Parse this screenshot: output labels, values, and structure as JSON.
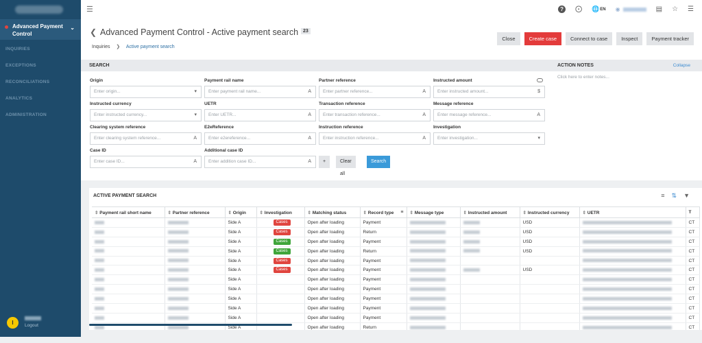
{
  "sidebar": {
    "active_item": "Advanced Payment Control",
    "items": [
      "INQUIRIES",
      "EXCEPTIONS",
      "RECONCILIATIONS",
      "ANALYTICS",
      "ADMINISTRATION"
    ],
    "user_initial": "I",
    "logout": "Logout"
  },
  "topbar": {
    "lang": "EN"
  },
  "header": {
    "title": "Advanced Payment Control - Active payment search",
    "count": "23",
    "breadcrumb_root": "Inquiries",
    "breadcrumb_current": "Active payment search",
    "actions": [
      "Close",
      "Create case",
      "Connect to case",
      "Inspect",
      "Payment tracker"
    ]
  },
  "search": {
    "heading": "SEARCH",
    "fields": [
      {
        "label": "Origin",
        "placeholder": "Enter origin...",
        "icon": "chevron"
      },
      {
        "label": "Payment rail name",
        "placeholder": "Enter payment rail name...",
        "icon": "text"
      },
      {
        "label": "Partner reference",
        "placeholder": "Enter partner reference...",
        "icon": "text"
      },
      {
        "label": "Instructed amount",
        "placeholder": "Enter instructed amount...",
        "icon": "dollar"
      },
      {
        "label": "Instructed currency",
        "placeholder": "Enter instructed currency...",
        "icon": "chevron"
      },
      {
        "label": "UETR",
        "placeholder": "Enter UETR...",
        "icon": "text"
      },
      {
        "label": "Transaction reference",
        "placeholder": "Enter transaction reference...",
        "icon": "text"
      },
      {
        "label": "Message reference",
        "placeholder": "Enter message reference...",
        "icon": "text"
      },
      {
        "label": "Clearing system reference",
        "placeholder": "Enter clearing system reference...",
        "icon": "text"
      },
      {
        "label": "E2eReference",
        "placeholder": "Enter e2ereference...",
        "icon": "text"
      },
      {
        "label": "Instruction reference",
        "placeholder": "Enter instruction reference...",
        "icon": "text"
      },
      {
        "label": "Investigation",
        "placeholder": "Enter investigation...",
        "icon": "chevron"
      },
      {
        "label": "Case ID",
        "placeholder": "Enter case ID...",
        "icon": "text"
      },
      {
        "label": "Additional case ID",
        "placeholder": "Enter addition case ID...",
        "icon": "text"
      }
    ],
    "add_label": "+",
    "clear_label": "Clear all",
    "search_label": "Search"
  },
  "notes": {
    "heading": "ACTION NOTES",
    "collapse": "Collapse",
    "placeholder": "Click here to enter notes..."
  },
  "results": {
    "heading": "ACTIVE PAYMENT SEARCH",
    "columns": [
      "Payment rail short name",
      "Partner reference",
      "Origin",
      "Investigation",
      "Matching status",
      "Record type",
      "Message type",
      "Instructed amount",
      "Instructed currency",
      "UETR",
      "T"
    ],
    "rows": [
      {
        "origin": "Side A",
        "inv": "Cases",
        "inv_color": "red",
        "status": "Open after loading",
        "type": "Payment",
        "amt": true,
        "cur": "USD",
        "last": "CT"
      },
      {
        "origin": "Side A",
        "inv": "Cases",
        "inv_color": "red",
        "status": "Open after loading",
        "type": "Return",
        "amt": true,
        "cur": "USD",
        "last": "CT"
      },
      {
        "origin": "Side A",
        "inv": "Cases",
        "inv_color": "green",
        "status": "Open after loading",
        "type": "Payment",
        "amt": true,
        "cur": "USD",
        "last": "CT"
      },
      {
        "origin": "Side A",
        "inv": "Cases",
        "inv_color": "green",
        "status": "Open after loading",
        "type": "Return",
        "amt": true,
        "cur": "USD",
        "last": "CT"
      },
      {
        "origin": "Side A",
        "inv": "Cases",
        "inv_color": "red",
        "status": "Open after loading",
        "type": "Payment",
        "amt": false,
        "cur": "",
        "last": "CT"
      },
      {
        "origin": "Side A",
        "inv": "Cases",
        "inv_color": "red",
        "status": "Open after loading",
        "type": "Payment",
        "amt": true,
        "cur": "USD",
        "last": "CT"
      },
      {
        "origin": "Side A",
        "inv": "",
        "inv_color": "",
        "status": "Open after loading",
        "type": "Payment",
        "amt": false,
        "cur": "",
        "last": "CT"
      },
      {
        "origin": "Side A",
        "inv": "",
        "inv_color": "",
        "status": "Open after loading",
        "type": "Payment",
        "amt": false,
        "cur": "",
        "last": "CT"
      },
      {
        "origin": "Side A",
        "inv": "",
        "inv_color": "",
        "status": "Open after loading",
        "type": "Payment",
        "amt": false,
        "cur": "",
        "last": "CT"
      },
      {
        "origin": "Side A",
        "inv": "",
        "inv_color": "",
        "status": "Open after loading",
        "type": "Payment",
        "amt": false,
        "cur": "",
        "last": "CT"
      },
      {
        "origin": "Side A",
        "inv": "",
        "inv_color": "",
        "status": "Open after loading",
        "type": "Payment",
        "amt": false,
        "cur": "",
        "last": "CT"
      },
      {
        "origin": "Side A",
        "inv": "",
        "inv_color": "",
        "status": "Open after loading",
        "type": "Return",
        "amt": false,
        "cur": "",
        "last": "CT"
      }
    ]
  }
}
